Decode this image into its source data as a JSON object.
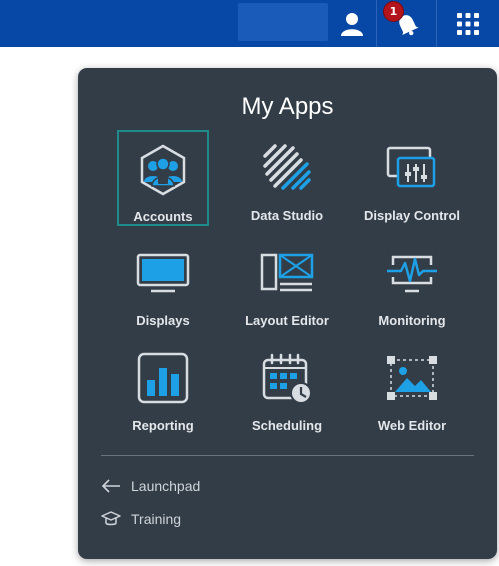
{
  "topbar": {
    "notification_count": "1",
    "icons": [
      "user-icon",
      "bell-icon",
      "apps-grid-icon"
    ]
  },
  "panel": {
    "title": "My Apps",
    "apps": [
      {
        "label": "Accounts",
        "icon": "accounts-icon",
        "selected": true
      },
      {
        "label": "Data Studio",
        "icon": "data-studio-icon"
      },
      {
        "label": "Display Control",
        "icon": "display-control-icon"
      },
      {
        "label": "Displays",
        "icon": "displays-icon"
      },
      {
        "label": "Layout Editor",
        "icon": "layout-editor-icon"
      },
      {
        "label": "Monitoring",
        "icon": "monitoring-icon"
      },
      {
        "label": "Reporting",
        "icon": "reporting-icon"
      },
      {
        "label": "Scheduling",
        "icon": "scheduling-icon"
      },
      {
        "label": "Web Editor",
        "icon": "web-editor-icon"
      }
    ],
    "footer": [
      {
        "label": "Launchpad",
        "icon": "arrow-left-icon"
      },
      {
        "label": "Training",
        "icon": "graduation-cap-icon"
      }
    ]
  },
  "colors": {
    "topbar": "#0747a6",
    "panel": "#333d48",
    "accent": "#1ea0e6",
    "selected_border": "#1f8c8c",
    "badge": "#b3131b"
  }
}
